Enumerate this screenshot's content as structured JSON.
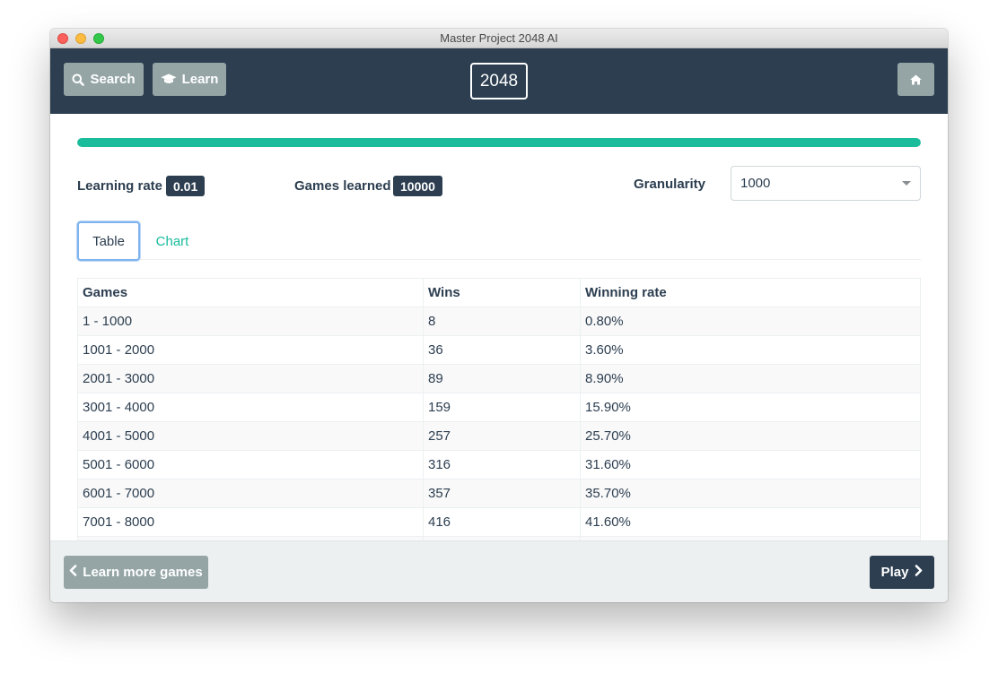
{
  "window": {
    "title": "Master Project 2048 AI"
  },
  "navbar": {
    "search_label": "Search",
    "learn_label": "Learn",
    "brand": "2048",
    "search_icon": "search-icon",
    "learn_icon": "graduation-cap-icon",
    "home_icon": "home-icon"
  },
  "progress": {
    "percent": 100,
    "color": "#1abc9c"
  },
  "stats": {
    "learning_rate_label": "Learning rate",
    "learning_rate_value": "0.01",
    "games_learned_label": "Games learned",
    "games_learned_value": "10000",
    "granularity_label": "Granularity",
    "granularity_value": "1000"
  },
  "tabs": [
    {
      "label": "Table",
      "active": true
    },
    {
      "label": "Chart",
      "active": false
    }
  ],
  "table": {
    "headers": [
      "Games",
      "Wins",
      "Winning rate"
    ],
    "rows": [
      [
        "1 - 1000",
        "8",
        "0.80%"
      ],
      [
        "1001 - 2000",
        "36",
        "3.60%"
      ],
      [
        "2001 - 3000",
        "89",
        "8.90%"
      ],
      [
        "3001 - 4000",
        "159",
        "15.90%"
      ],
      [
        "4001 - 5000",
        "257",
        "25.70%"
      ],
      [
        "5001 - 6000",
        "316",
        "31.60%"
      ],
      [
        "6001 - 7000",
        "357",
        "35.70%"
      ],
      [
        "7001 - 8000",
        "416",
        "41.60%"
      ],
      [
        "",
        "",
        ""
      ]
    ]
  },
  "footer": {
    "back_label": "Learn more games",
    "play_label": "Play",
    "back_icon": "chevron-left-icon",
    "play_icon": "chevron-right-icon"
  },
  "colors": {
    "navbar": "#2c3e50",
    "accent": "#1abc9c",
    "muted_button": "#95a5a6"
  }
}
